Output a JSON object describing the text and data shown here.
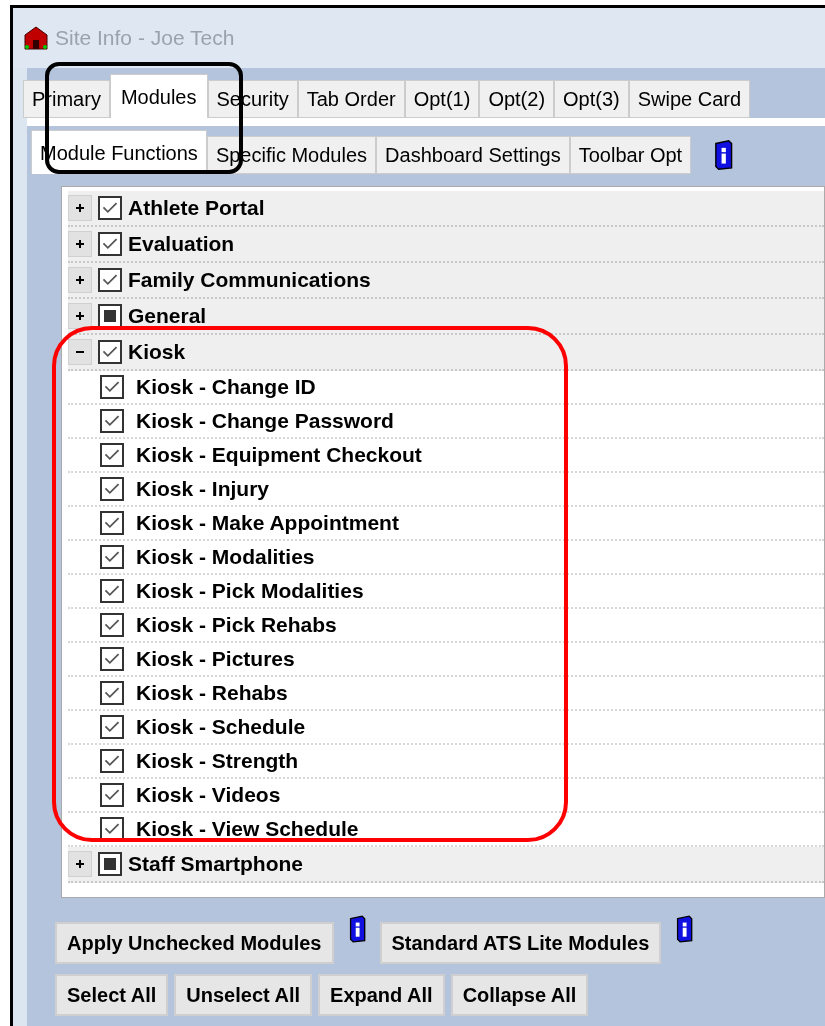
{
  "window": {
    "title": "Site Info - Joe Tech"
  },
  "tabs": [
    {
      "label": "Primary",
      "selected": false
    },
    {
      "label": "Modules",
      "selected": true
    },
    {
      "label": "Security",
      "selected": false
    },
    {
      "label": "Tab Order",
      "selected": false
    },
    {
      "label": "Opt(1)",
      "selected": false
    },
    {
      "label": "Opt(2)",
      "selected": false
    },
    {
      "label": "Opt(3)",
      "selected": false
    },
    {
      "label": "Swipe Card",
      "selected": false
    }
  ],
  "subtabs": [
    {
      "label": "Module Functions",
      "selected": true
    },
    {
      "label": "Specific Modules",
      "selected": false
    },
    {
      "label": "Dashboard Settings",
      "selected": false
    },
    {
      "label": "Toolbar Opt",
      "selected": false
    }
  ],
  "tree": [
    {
      "label": "Athlete Portal",
      "checked": true,
      "indeterminate": false,
      "expanded": false
    },
    {
      "label": "Evaluation",
      "checked": true,
      "indeterminate": false,
      "expanded": false
    },
    {
      "label": "Family Communications",
      "checked": true,
      "indeterminate": false,
      "expanded": false
    },
    {
      "label": "General",
      "checked": false,
      "indeterminate": true,
      "expanded": false
    },
    {
      "label": "Kiosk",
      "checked": true,
      "indeterminate": false,
      "expanded": true,
      "children": [
        {
          "label": "Kiosk - Change ID",
          "checked": true
        },
        {
          "label": "Kiosk - Change Password",
          "checked": true
        },
        {
          "label": "Kiosk - Equipment Checkout",
          "checked": true
        },
        {
          "label": "Kiosk - Injury",
          "checked": true
        },
        {
          "label": "Kiosk - Make Appointment",
          "checked": true
        },
        {
          "label": "Kiosk - Modalities",
          "checked": true
        },
        {
          "label": "Kiosk - Pick Modalities",
          "checked": true
        },
        {
          "label": "Kiosk - Pick Rehabs",
          "checked": true
        },
        {
          "label": "Kiosk - Pictures",
          "checked": true
        },
        {
          "label": "Kiosk - Rehabs",
          "checked": true
        },
        {
          "label": "Kiosk - Schedule",
          "checked": true
        },
        {
          "label": "Kiosk - Strength",
          "checked": true
        },
        {
          "label": "Kiosk - Videos",
          "checked": true
        },
        {
          "label": "Kiosk - View Schedule",
          "checked": true
        }
      ]
    },
    {
      "label": "Staff Smartphone",
      "checked": false,
      "indeterminate": true,
      "expanded": false
    }
  ],
  "action_buttons": [
    {
      "label": "Apply Unchecked Modules"
    },
    {
      "label": "Standard ATS Lite Modules"
    }
  ],
  "bottom_buttons": [
    {
      "label": "Select All"
    },
    {
      "label": "Unselect All"
    },
    {
      "label": "Expand All"
    },
    {
      "label": "Collapse All"
    }
  ]
}
